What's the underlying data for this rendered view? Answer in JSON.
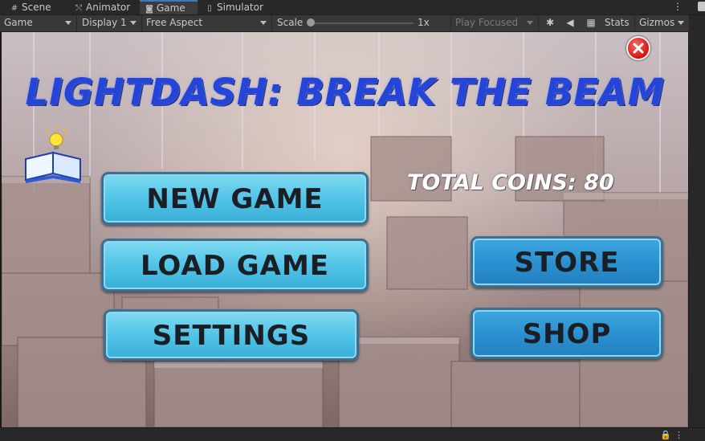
{
  "tabs": [
    {
      "label": "Scene",
      "icon": "grid-icon"
    },
    {
      "label": "Animator",
      "icon": "animator-icon"
    },
    {
      "label": "Game",
      "icon": "gamepad-icon"
    },
    {
      "label": "Simulator",
      "icon": "device-icon"
    }
  ],
  "toolbar": {
    "view_mode": "Game",
    "display": "Display 1",
    "aspect": "Free Aspect",
    "scale_label": "Scale",
    "scale_value": "1x",
    "play_mode": "Play Focused",
    "stats_label": "Stats",
    "gizmos_label": "Gizmos"
  },
  "game": {
    "title": "LIGHTDASH: BREAK THE BEAM",
    "coins_label": "TOTAL COINS: 80",
    "buttons": {
      "new_game": "NEW GAME",
      "load_game": "LOAD GAME",
      "settings": "SETTINGS",
      "store": "STORE",
      "shop": "SHOP"
    }
  },
  "colors": {
    "title": "#2545d8",
    "button_light": "#4fc2e6",
    "button_dark": "#2a8fcf",
    "close": "#d21414",
    "active_tab_accent": "#3a79bb"
  }
}
